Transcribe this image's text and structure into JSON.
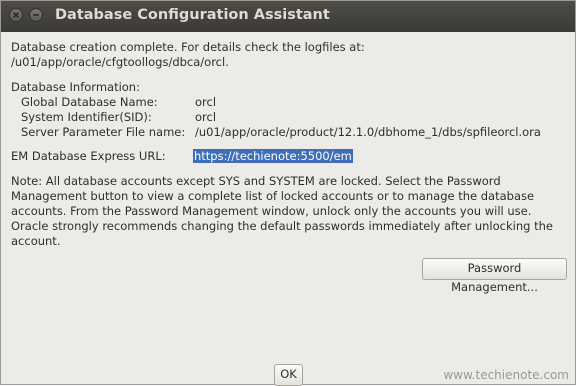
{
  "window": {
    "title": "Database Configuration Assistant"
  },
  "message": {
    "line1": "Database creation complete. For details check the logfiles at:",
    "line2": " /u01/app/oracle/cfgtoollogs/dbca/orcl."
  },
  "db_info": {
    "heading": "Database Information:",
    "rows": [
      {
        "label": "Global Database Name:",
        "value": "orcl"
      },
      {
        "label": "System Identifier(SID):",
        "value": "orcl"
      },
      {
        "label": "Server Parameter File name:",
        "value": "/u01/app/oracle/product/12.1.0/dbhome_1/dbs/spfileorcl.ora"
      }
    ]
  },
  "em": {
    "label": "EM Database Express URL:",
    "url": "https://techienote:5500/em"
  },
  "note": {
    "lines": [
      "Note: All database accounts except SYS and SYSTEM are locked. Select the Password",
      "Management button to view a complete list of locked accounts or to manage the database",
      "accounts. From the Password Management window, unlock only the accounts you will use.",
      "Oracle strongly recommends changing the default passwords immediately after unlocking the",
      "account."
    ]
  },
  "buttons": {
    "password_management": "Password Management...",
    "ok": "OK"
  },
  "watermark": "www.techienote.com"
}
